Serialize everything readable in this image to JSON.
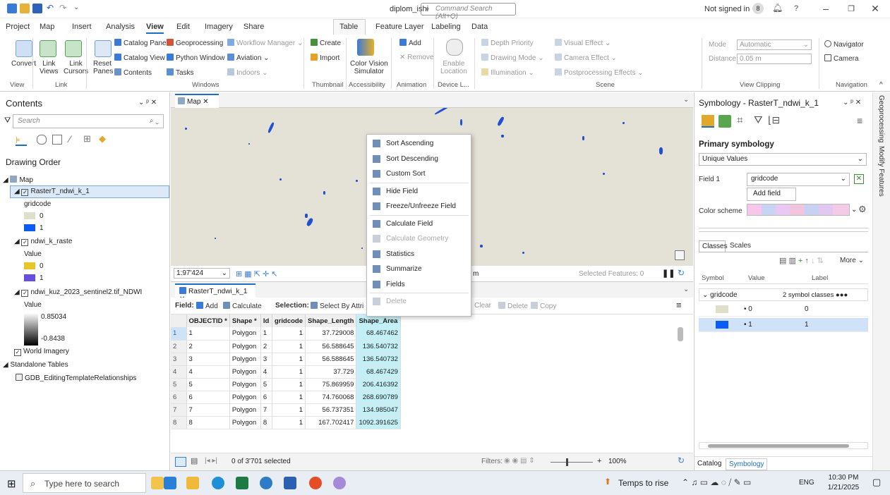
{
  "window": {
    "title": "diplom_ishi",
    "command_search": "Command Search (Alt+Q)",
    "sign_in": "Not signed in",
    "user_initial": "8",
    "help": "?"
  },
  "ribbon_tabs": [
    "Project",
    "Map",
    "Insert",
    "Analysis",
    "View",
    "Edit",
    "Imagery",
    "Share",
    "Table",
    "Feature Layer",
    "Labeling",
    "Data"
  ],
  "ribbon_active_tab": "View",
  "ribbon": {
    "view": {
      "convert": "Convert",
      "link_views": "Link\nViews",
      "link_cursors": "Link\nCursors",
      "group": "View",
      "link_group": "Link"
    },
    "windows": {
      "reset_panes": "Reset\nPanes",
      "catalog_pane": "Catalog Pane",
      "catalog_view": "Catalog View",
      "contents": "Contents",
      "geoprocessing": "Geoprocessing",
      "python_window": "Python Window",
      "tasks": "Tasks",
      "workflow_manager": "Workflow Manager",
      "aviation": "Aviation",
      "indoors": "Indoors",
      "group": "Windows"
    },
    "thumbnail": {
      "create": "Create",
      "import": "Import",
      "group": "Thumbnail"
    },
    "accessibility": {
      "color_vision": "Color Vision\nSimulator",
      "group": "Accessibility"
    },
    "animation": {
      "add": "Add",
      "remove": "Remove",
      "group": "Animation"
    },
    "device_location": {
      "enable": "Enable\nLocation",
      "group": "Device L..."
    },
    "scene": {
      "depth_priority": "Depth Priority",
      "drawing_mode": "Drawing Mode",
      "illumination": "Illumination",
      "visual_effect": "Visual Effect",
      "camera_effect": "Camera Effect",
      "postprocessing": "Postprocessing Effects",
      "group": "Scene"
    },
    "view_clipping": {
      "mode_label": "Mode",
      "mode_value": "Automatic",
      "distance_label": "Distance",
      "distance_value": "0.05 m",
      "group": "View Clipping"
    },
    "navigation": {
      "navigator": "Navigator",
      "camera": "Camera",
      "group": "Navigation"
    }
  },
  "contents": {
    "title": "Contents",
    "search_placeholder": "Search",
    "drawing_order": "Drawing Order",
    "map": "Map",
    "layer1": {
      "name": "RasterT_ndwi_k_1",
      "field": "gridcode",
      "classes": [
        "0",
        "1"
      ]
    },
    "layer2": {
      "name": "ndwi_k_raste",
      "field": "Value",
      "classes": [
        "0",
        "1"
      ]
    },
    "layer3": {
      "name": "ndwi_kuz_2023_sentinel2.tif_NDWI",
      "field": "Value",
      "high": "0.85034",
      "low": "-0.8438"
    },
    "world_imagery": "World Imagery",
    "standalone": "Standalone Tables",
    "table": "GDB_EditingTemplateRelationships"
  },
  "map": {
    "tab": "Map",
    "scale": "1:97'424",
    "units": "N m",
    "selected_features": "Selected Features: 0"
  },
  "context_menu": {
    "items": [
      {
        "label": "Sort Ascending",
        "icon": "sort-ascending-icon",
        "enabled": true
      },
      {
        "label": "Sort Descending",
        "icon": "sort-descending-icon",
        "enabled": true
      },
      {
        "label": "Custom Sort",
        "icon": "custom-sort-icon",
        "enabled": true
      },
      {
        "label": "Hide Field",
        "icon": "hide-field-icon",
        "enabled": true
      },
      {
        "label": "Freeze/Unfreeze Field",
        "icon": "freeze-field-icon",
        "enabled": true
      },
      {
        "label": "Calculate Field",
        "icon": "calculate-field-icon",
        "enabled": true
      },
      {
        "label": "Calculate Geometry",
        "icon": "calculate-geometry-icon",
        "enabled": false
      },
      {
        "label": "Statistics",
        "icon": "statistics-icon",
        "enabled": true
      },
      {
        "label": "Summarize",
        "icon": "summarize-icon",
        "enabled": true
      },
      {
        "label": "Fields",
        "icon": "fields-icon",
        "enabled": true
      },
      {
        "label": "Delete",
        "icon": "delete-icon",
        "enabled": false
      }
    ]
  },
  "attribute_table": {
    "tab": "RasterT_ndwi_k_1",
    "toolbar": {
      "field_label": "Field:",
      "add": "Add",
      "calculate": "Calculate",
      "selection_label": "Selection:",
      "select_by_attr": "Select By Attri",
      "clear": "Clear",
      "delete": "Delete",
      "copy": "Copy"
    },
    "columns": [
      "OBJECTID *",
      "Shape *",
      "Id",
      "gridcode",
      "Shape_Length",
      "Shape_Area"
    ],
    "rows": [
      [
        "1",
        "1",
        "Polygon",
        "1",
        "1",
        "37.729008",
        "68.467462"
      ],
      [
        "2",
        "2",
        "Polygon",
        "2",
        "1",
        "56.588645",
        "136.540732"
      ],
      [
        "3",
        "3",
        "Polygon",
        "3",
        "1",
        "56.588645",
        "136.540732"
      ],
      [
        "4",
        "4",
        "Polygon",
        "4",
        "1",
        "37.729",
        "68.467429"
      ],
      [
        "5",
        "5",
        "Polygon",
        "5",
        "1",
        "75.869959",
        "206.416392"
      ],
      [
        "6",
        "6",
        "Polygon",
        "6",
        "1",
        "74.760068",
        "268.690789"
      ],
      [
        "7",
        "7",
        "Polygon",
        "7",
        "1",
        "56.737351",
        "134.985047"
      ],
      [
        "8",
        "8",
        "Polygon",
        "8",
        "1",
        "167.702417",
        "1092.391625"
      ]
    ],
    "status": "0 of 3'701 selected",
    "filters": "Filters:",
    "zoom": "100%"
  },
  "symbology": {
    "title": "Symbology - RasterT_ndwi_k_1",
    "primary": "Primary symbology",
    "renderer": "Unique Values",
    "field1_label": "Field 1",
    "field1_value": "gridcode",
    "add_field": "Add field",
    "color_scheme": "Color scheme",
    "tabs": [
      "Classes",
      "Scales"
    ],
    "more": "More",
    "columns": [
      "Symbol",
      "Value",
      "Label"
    ],
    "group_field": "gridcode",
    "group_info": "2 symbol classes",
    "classes": [
      {
        "value": "0",
        "label": "0",
        "color": "#e0dfc9"
      },
      {
        "value": "1",
        "label": "1",
        "color": "#0b5cf2"
      }
    ],
    "bottom_tabs": [
      "Catalog",
      "Symbology"
    ]
  },
  "side_tabs": [
    "Geoprocessing",
    "Modify Features"
  ],
  "taskbar": {
    "search": "Type here to search",
    "weather": "Temps to rise",
    "lang": "ENG",
    "time": "10:30 PM",
    "date": "1/21/2025"
  },
  "colors": {
    "accent": "#1d6fc4",
    "water": "#1e4fd6",
    "land": "#e4e1d6",
    "selected_col": "#c3f0f6"
  }
}
